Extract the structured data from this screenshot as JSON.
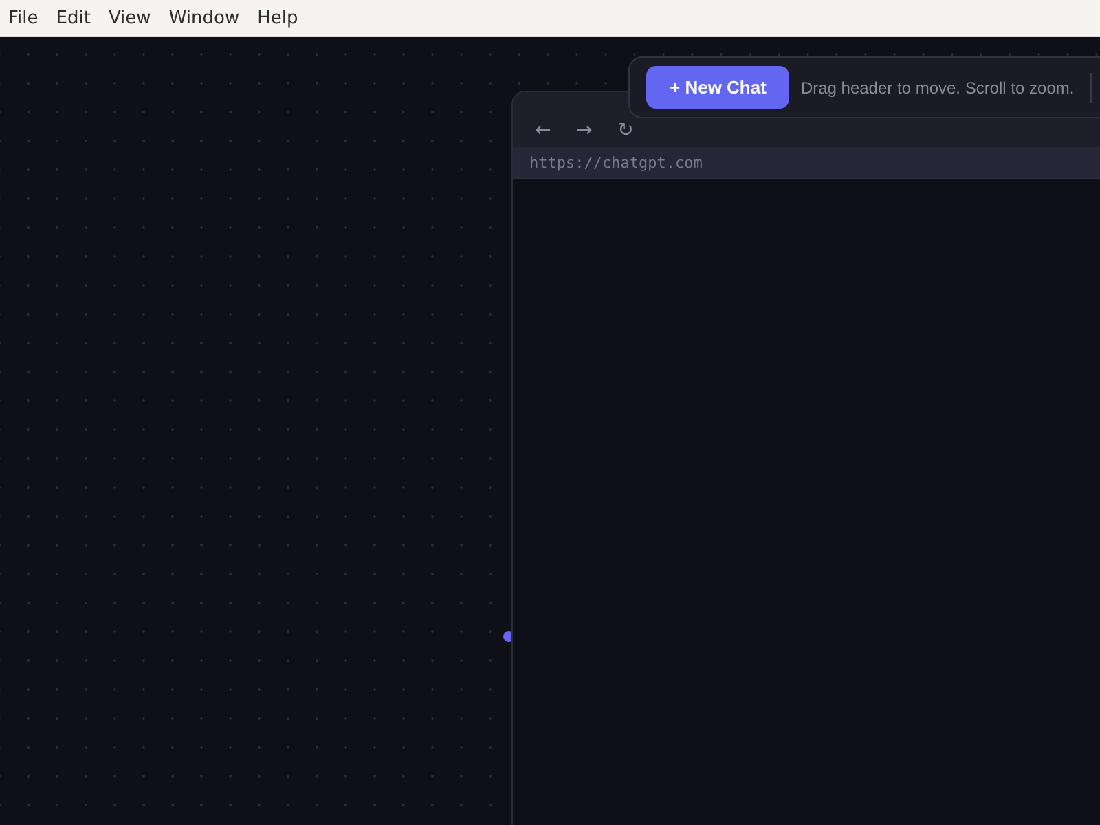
{
  "menu_bar": {
    "items": [
      "File",
      "Edit",
      "View",
      "Window",
      "Help"
    ]
  },
  "browser_window": {
    "nav_buttons": [
      "←",
      "→",
      "↻"
    ],
    "url": "https://chatgpt.com"
  },
  "toolbar": {
    "new_chat_button": "+ New Chat",
    "hint": "Drag header to move. Scroll to zoom."
  }
}
